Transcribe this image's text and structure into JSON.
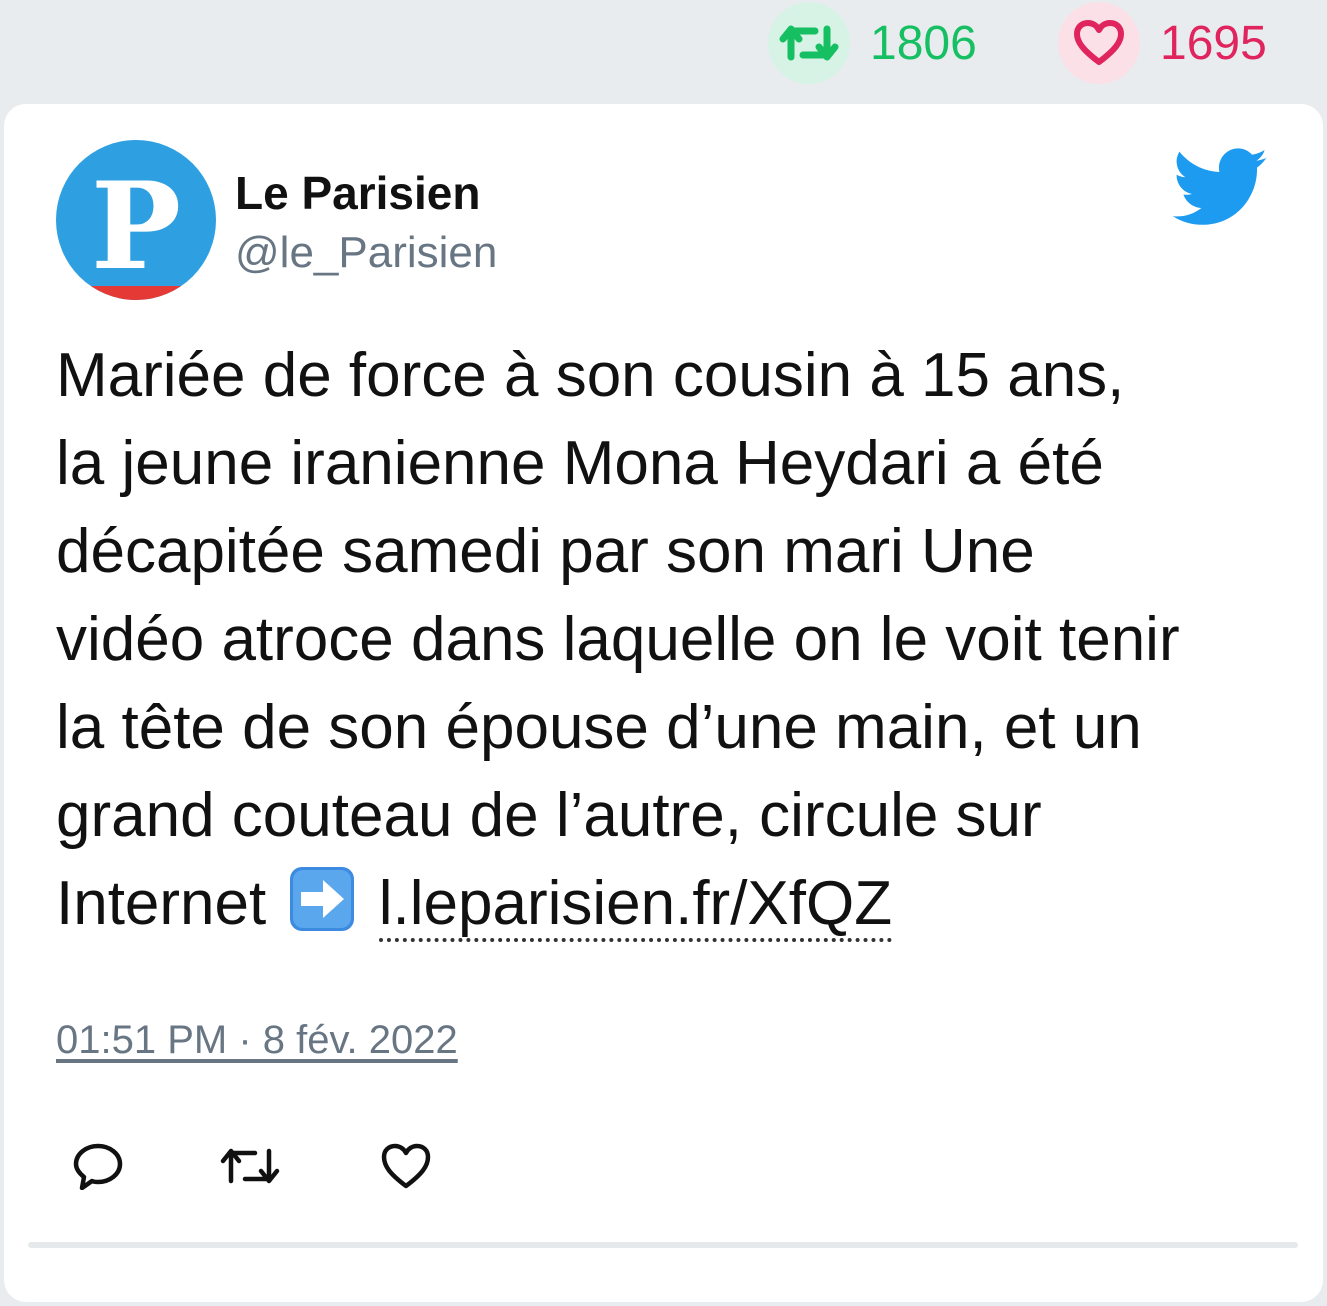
{
  "stats": {
    "retweet_count": "1806",
    "like_count": "1695"
  },
  "author": {
    "name": "Le Parisien",
    "handle": "@le_Parisien",
    "avatar_letter": "P"
  },
  "tweet": {
    "lines": [
      "Mariée de force à son cousin à 15 ans,",
      "la jeune iranienne Mona Heydari a été",
      "décapitée samedi par son mari Une",
      "vidéo atroce dans laquelle on le voit tenir",
      "la tête de son épouse d’une main, et un",
      "grand couteau de l’autre, circule sur"
    ],
    "last_line_text": "Internet",
    "link_text": "l.leparisien.fr/XfQZ",
    "timestamp": "01:51 PM · 8 fév. 2022"
  },
  "icons": {
    "retweet_stat": "retweet-icon",
    "like_stat": "heart-icon",
    "twitter": "twitter-bird-icon",
    "arrow": "right-arrow-emoji-icon",
    "reply": "reply-icon",
    "retweet": "retweet-icon",
    "like": "heart-icon"
  },
  "colors": {
    "retweet_green": "#17bf63",
    "like_red": "#e0245e",
    "twitter_blue": "#1d9bf0",
    "avatar_blue": "#2e9fe0",
    "avatar_red": "#e53935"
  }
}
